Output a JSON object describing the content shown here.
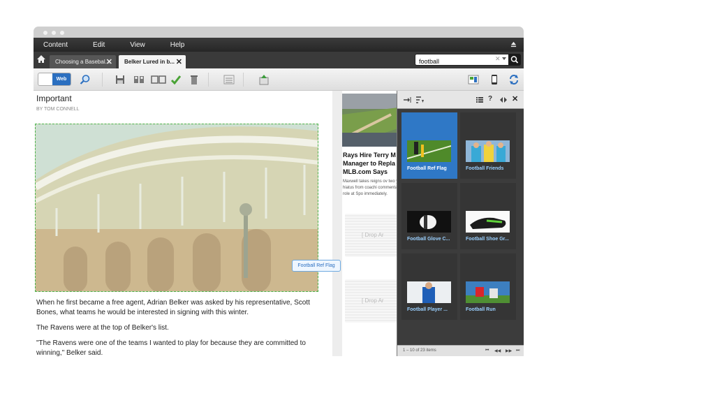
{
  "menu": {
    "items": [
      "Content",
      "Edit",
      "View",
      "Help"
    ]
  },
  "tabs": [
    {
      "label": "Choosing a Basebal..."
    },
    {
      "label": "Belker Lured in b..."
    }
  ],
  "search": {
    "value": "football"
  },
  "toolbar": {
    "toggle_label": "Web"
  },
  "article": {
    "title": "Important",
    "byline": "BY TOM CONNELL",
    "paragraphs": [
      "When he first became a free agent, Adrian Belker was asked by his representative, Scott Bones, what teams he would be interested in signing with this winter.",
      "The Ravens were at the top of Belker's list.",
      "\"The Ravens were one of the teams I wanted to play for because they are committed to winning,\" Belker said."
    ]
  },
  "sidebar_story": {
    "headline": "Rays Hire Terry M Manager to Repla MLB.com Says",
    "body": "Maxwell takes reigns ov two year hiatus from coachi commentator role at Spo immediately."
  },
  "drop_zones": [
    "[ Drop Ar",
    "[ Drop Ar"
  ],
  "drag_tooltip": "Football Ref Flag",
  "media_panel": {
    "items": [
      {
        "label": "Football Ref Flag",
        "selected": true
      },
      {
        "label": "Football Friends",
        "selected": false
      },
      {
        "label": "Football Glove C...",
        "selected": false
      },
      {
        "label": "Football Shoe Gr...",
        "selected": false
      },
      {
        "label": "Football Player ...",
        "selected": false
      },
      {
        "label": "Football Run",
        "selected": false
      }
    ],
    "count_text": "1 – 10 of 23 items"
  },
  "colors": {
    "accent": "#2f78c6",
    "panel_bg": "#3c3c3c",
    "drop_outline": "#4bb34b"
  }
}
